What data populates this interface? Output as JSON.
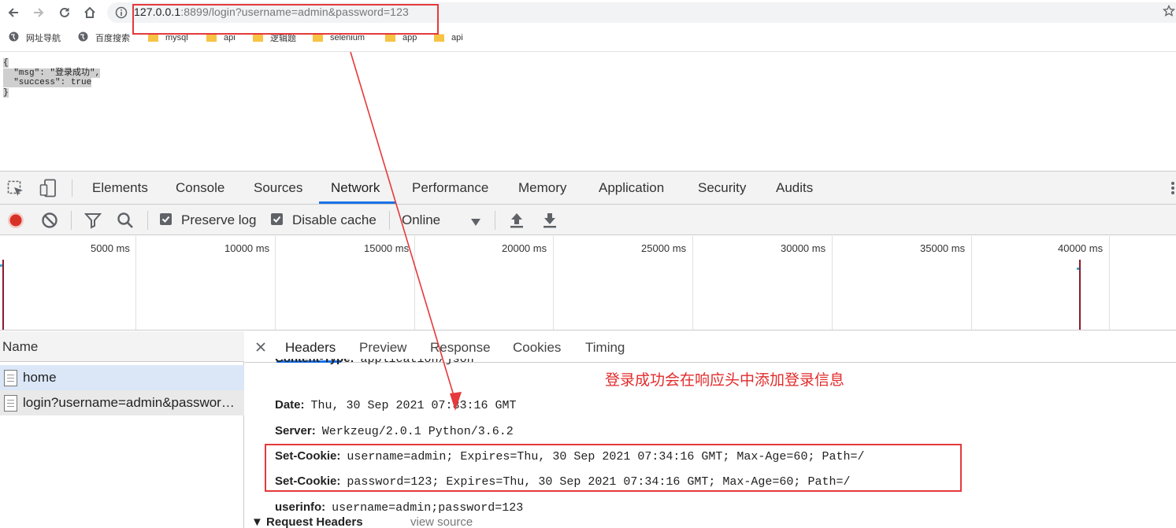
{
  "browser": {
    "url_host": "127.0.0.1",
    "url_rest": ":8899/login?username=admin&password=123",
    "bookmarks": [
      "网址导航",
      "百度搜索",
      "mysql",
      "api",
      "逻辑题",
      "selenium",
      "app",
      "api"
    ]
  },
  "page": {
    "json_lines": [
      "{",
      "  \"msg\": \"登录成功\",",
      "  \"success\": true",
      "}"
    ]
  },
  "devtools": {
    "tabs": [
      "Elements",
      "Console",
      "Sources",
      "Network",
      "Performance",
      "Memory",
      "Application",
      "Security",
      "Audits"
    ],
    "active_tab": "Network",
    "toolbar": {
      "preserve_log": "Preserve log",
      "disable_cache": "Disable cache",
      "throttle": "Online"
    },
    "timeline_ticks": [
      "5000 ms",
      "10000 ms",
      "15000 ms",
      "20000 ms",
      "25000 ms",
      "30000 ms",
      "35000 ms",
      "40000 ms"
    ],
    "requests": {
      "header": "Name",
      "items": [
        "home",
        "login?username=admin&password=123"
      ]
    },
    "details": {
      "tabs": [
        "Headers",
        "Preview",
        "Response",
        "Cookies",
        "Timing"
      ],
      "active_tab": "Headers",
      "headers": [
        {
          "key": "Content-Type:",
          "value": "application/json"
        },
        {
          "key": "Date:",
          "value": "Thu, 30 Sep 2021 07:33:16 GMT"
        },
        {
          "key": "Server:",
          "value": "Werkzeug/2.0.1 Python/3.6.2"
        },
        {
          "key": "Set-Cookie:",
          "value": "username=admin; Expires=Thu, 30 Sep 2021 07:34:16 GMT; Max-Age=60; Path=/"
        },
        {
          "key": "Set-Cookie:",
          "value": "password=123; Expires=Thu, 30 Sep 2021 07:34:16 GMT; Max-Age=60; Path=/"
        },
        {
          "key": "userinfo:",
          "value": "username=admin;password=123"
        }
      ],
      "request_headers": "▼ Request Headers",
      "view_source": "view source",
      "annotation": "登录成功会在响应头中添加登录信息"
    }
  },
  "colors": {
    "accent": "#1a73e8",
    "record": "#d93025",
    "annotation": "#e22b2b",
    "highlight_box": "#e5393b"
  }
}
